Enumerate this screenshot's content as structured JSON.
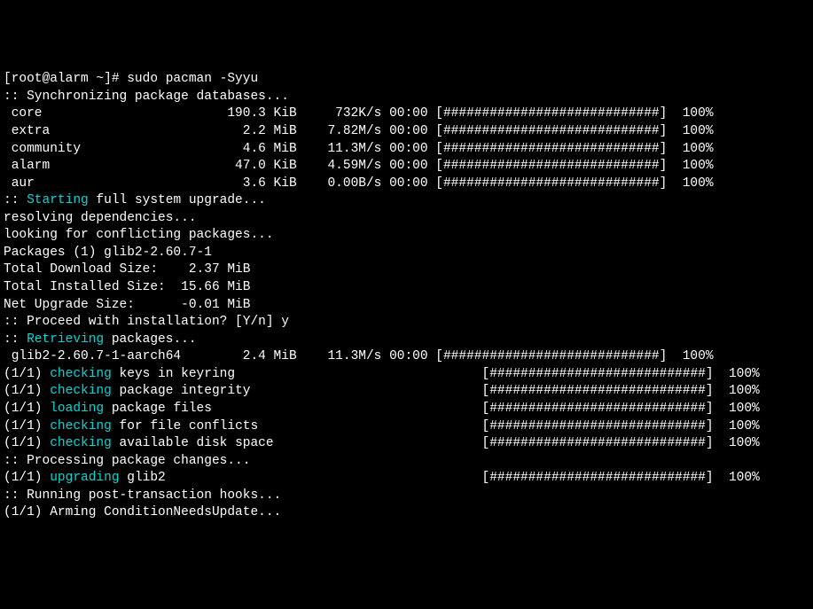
{
  "prompt": "[root@alarm ~]# sudo pacman -Syyu",
  "sync_header": ":: Synchronizing package databases...",
  "repos": [
    {
      "name": " core",
      "size": "190.3 KiB",
      "rate": " 732K/s",
      "time": "00:00",
      "bar": "[############################]",
      "pct": "100%"
    },
    {
      "name": " extra",
      "size": "  2.2 MiB",
      "rate": "7.82M/s",
      "time": "00:00",
      "bar": "[############################]",
      "pct": "100%"
    },
    {
      "name": " community",
      "size": "  4.6 MiB",
      "rate": "11.3M/s",
      "time": "00:00",
      "bar": "[############################]",
      "pct": "100%"
    },
    {
      "name": " alarm",
      "size": " 47.0 KiB",
      "rate": "4.59M/s",
      "time": "00:00",
      "bar": "[############################]",
      "pct": "100%"
    },
    {
      "name": " aur",
      "size": "  3.6 KiB",
      "rate": "0.00B/s",
      "time": "00:00",
      "bar": "[############################]",
      "pct": "100%"
    }
  ],
  "starting_prefix": ":: ",
  "starting_word": "Starting",
  "starting_suffix": " full system upgrade...",
  "resolving": "resolving dependencies...",
  "looking": "looking for conflicting packages...",
  "packages_line": "Packages (1) glib2-2.60.7-1",
  "totals": [
    "Total Download Size:    2.37 MiB",
    "Total Installed Size:  15.66 MiB",
    "Net Upgrade Size:      -0.01 MiB"
  ],
  "proceed": ":: Proceed with installation? [Y/n] y",
  "retrieving_prefix": ":: ",
  "retrieving_word": "Retrieving",
  "retrieving_suffix": " packages...",
  "download": {
    "name": " glib2-2.60.7-1-aarch64",
    "size": "  2.4 MiB",
    "rate": "11.3M/s",
    "time": "00:00",
    "bar": "[############################]",
    "pct": "100%"
  },
  "steps": [
    {
      "idx": "(1/1) ",
      "verb": "checking",
      "rest": " keys in keyring",
      "bar": "[############################]",
      "pct": "100%"
    },
    {
      "idx": "(1/1) ",
      "verb": "checking",
      "rest": " package integrity",
      "bar": "[############################]",
      "pct": "100%"
    },
    {
      "idx": "(1/1) ",
      "verb": "loading",
      "rest": " package files",
      "bar": "[############################]",
      "pct": "100%"
    },
    {
      "idx": "(1/1) ",
      "verb": "checking",
      "rest": " for file conflicts",
      "bar": "[############################]",
      "pct": "100%"
    },
    {
      "idx": "(1/1) ",
      "verb": "checking",
      "rest": " available disk space",
      "bar": "[############################]",
      "pct": "100%"
    }
  ],
  "processing": ":: Processing package changes...",
  "upgrade": {
    "idx": "(1/1) ",
    "verb": "upgrading",
    "rest": " glib2",
    "bar": "[############################]",
    "pct": "100%"
  },
  "hooks": ":: Running post-transaction hooks...",
  "arming": "(1/1) Arming ConditionNeedsUpdate..."
}
